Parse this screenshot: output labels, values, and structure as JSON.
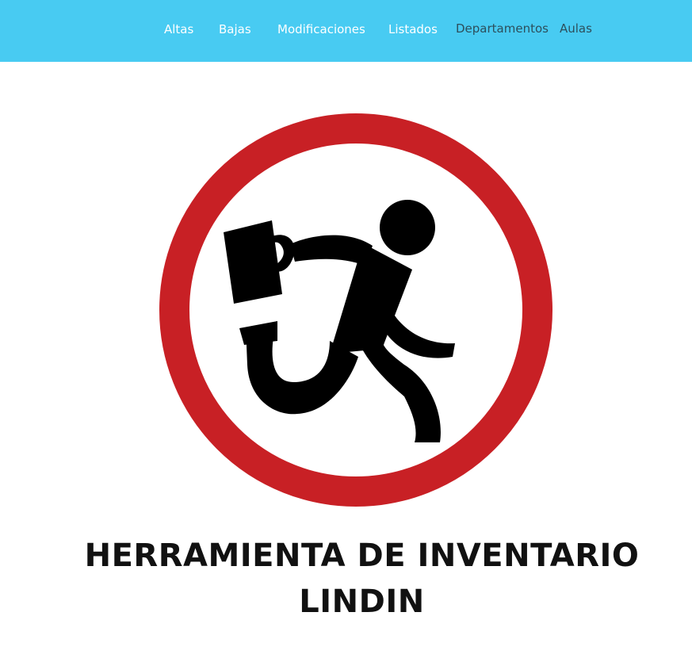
{
  "nav": {
    "items": [
      {
        "label": "Altas",
        "style": "white"
      },
      {
        "label": "Bajas",
        "style": "white"
      },
      {
        "label": "Modificaciones",
        "style": "white"
      },
      {
        "label": "Listados",
        "style": "white"
      },
      {
        "label": "Departamentos",
        "style": "dark"
      },
      {
        "label": "Aulas",
        "style": "dark"
      }
    ]
  },
  "logo": {
    "icon": "running-man-with-briefcase-prohibition-sign",
    "ring_color": "#c82025",
    "figure_color": "#000000",
    "text_lines": [
      "HERRAMIENTA DE INVENTARIO",
      "LINDIN"
    ]
  },
  "colors": {
    "header_bg": "#48cbf2",
    "nav_white": "#ffffff",
    "nav_dark": "#2d4f5c"
  }
}
